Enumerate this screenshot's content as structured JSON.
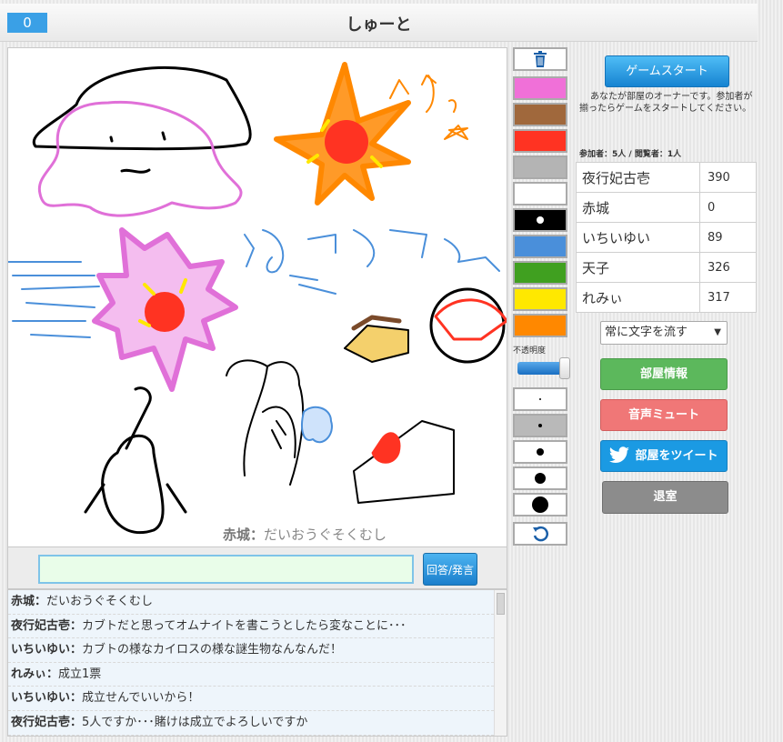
{
  "header": {
    "counter": "0",
    "title": "しゅーと"
  },
  "canvas": {
    "caption_name": "赤城：",
    "caption_text": "だいおうぐそくむし"
  },
  "answer": {
    "value": "",
    "button_label": "回答/発言"
  },
  "chat": [
    {
      "name": "赤城：",
      "text": "だいおうぐそくむし"
    },
    {
      "name": "夜行妃古壱：",
      "text": "カブトだと思ってオムナイトを書こうとしたら変なことに･･･"
    },
    {
      "name": "いちいゆい：",
      "text": "カブトの様なカイロスの様な謎生物なんなんだ！"
    },
    {
      "name": "れみぃ：",
      "text": "成立1票"
    },
    {
      "name": "いちいゆい：",
      "text": "成立せんでいいから！"
    },
    {
      "name": "夜行妃古壱：",
      "text": "5人ですか･･･賭けは成立でよろしいですか"
    }
  ],
  "tools": {
    "trash_icon": "trash-icon",
    "colors": [
      "#f070d8",
      "#a0683c",
      "#ff3322",
      "#b4b4b4",
      "#ffffff",
      "#000000",
      "#4a8fda",
      "#40a020",
      "#ffe800",
      "#ff8800"
    ],
    "selected_color_index": 5,
    "opacity_label": "不透明度",
    "opacity_value": 1.0,
    "sizes": [
      2,
      4,
      8,
      12,
      18
    ],
    "selected_size_index": 1,
    "undo_icon": "undo-icon"
  },
  "side": {
    "start_button": "ゲームスタート",
    "owner_note": "あなたが部屋のオーナーです。参加者が揃ったらゲームをスタートしてください。",
    "participants_label": "参加者：5人 / 閲覧者：1人",
    "scores": [
      {
        "name": "夜行妃古壱",
        "points": "390"
      },
      {
        "name": "赤城",
        "points": "0"
      },
      {
        "name": "いちいゆい",
        "points": "89"
      },
      {
        "name": "天子",
        "points": "326"
      },
      {
        "name": "れみぃ",
        "points": "317"
      }
    ],
    "flow_select": "常に文字を流す",
    "room_info_button": "部屋情報",
    "mute_button": "音声ミュート",
    "tweet_button": "部屋をツイート",
    "leave_button": "退室"
  }
}
